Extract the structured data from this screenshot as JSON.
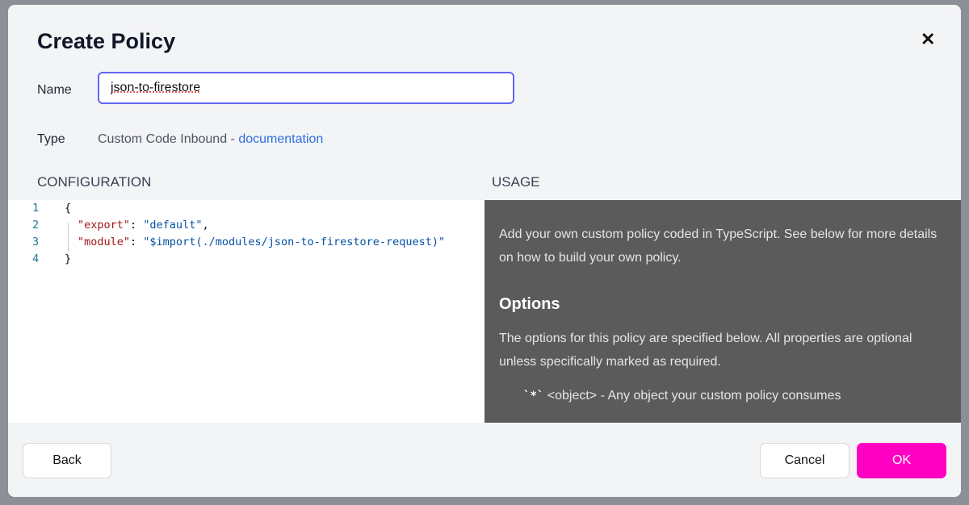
{
  "dialog": {
    "title": "Create Policy",
    "close_icon": "close-icon",
    "name_label": "Name",
    "name_value": "json-to-firestore",
    "type_label": "Type",
    "type_value": "Custom Code Inbound - ",
    "type_link": "documentation",
    "configuration_label": "CONFIGURATION",
    "usage_label": "USAGE"
  },
  "editor": {
    "lines": [
      {
        "n": "1",
        "text": "{"
      },
      {
        "n": "2",
        "key": "\"export\"",
        "sep": ": ",
        "value": "\"default\"",
        "end": ","
      },
      {
        "n": "3",
        "key": "\"module\"",
        "sep": ": ",
        "value": "\"$import(./modules/json-to-firestore-request)\"",
        "end": ""
      },
      {
        "n": "4",
        "text": "}"
      }
    ]
  },
  "usage": {
    "intro": "Add your own custom policy coded in TypeScript. See below for more details on how to build your own policy.",
    "options_heading": "Options",
    "options_text": "The options for this policy are specified below. All properties are optional unless specifically marked as required.",
    "option_code": "`*`",
    "option_desc": " <object> - Any object your custom policy consumes"
  },
  "footer": {
    "back": "Back",
    "cancel": "Cancel",
    "ok": "OK"
  },
  "colors": {
    "accent": "#ff00c3",
    "link": "#2f6fdf",
    "focus": "#6366f1"
  }
}
